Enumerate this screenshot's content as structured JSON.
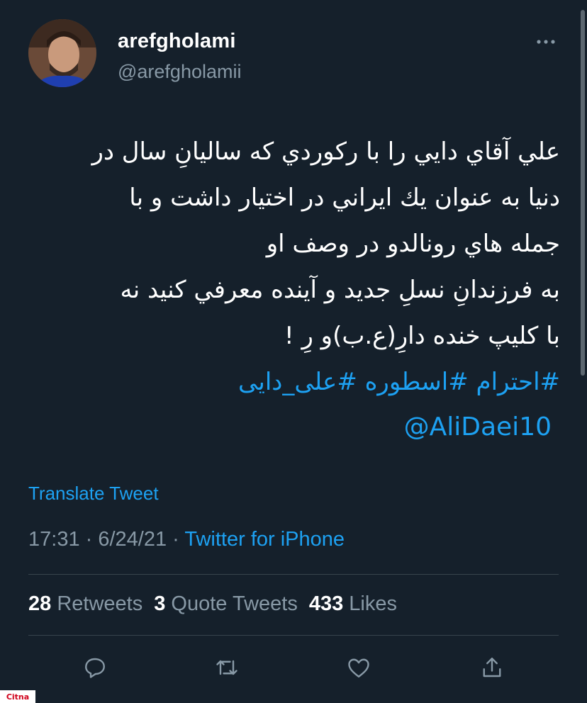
{
  "user": {
    "display_name": "arefgholami",
    "handle": "@arefgholamii"
  },
  "tweet": {
    "lines": [
      "علي آقاي دايي را با ركوردي كه ساليانِ سال  در",
      "دنيا به عنوان يك ايراني در اختيار داشت و با",
      "جمله هاي رونالدو در وصف او",
      "به فرزندانِ نسلِ جديد و آينده معرفي كنيد نه",
      "با كليپ خنده دارِ(ع.ب)و رِ !"
    ],
    "hashtags": "#احترام #اسطوره #علی_دایی",
    "mention": "@AliDaei10"
  },
  "translate_label": "Translate Tweet",
  "meta": {
    "time": "17:31",
    "separator": " · ",
    "date": "6/24/21",
    "source": "Twitter for iPhone"
  },
  "stats": {
    "retweets_count": "28",
    "retweets_label": "Retweets",
    "quote_count": "3",
    "quote_label": "Quote Tweets",
    "likes_count": "433",
    "likes_label": "Likes"
  },
  "actions": [
    "reply-icon",
    "retweet-icon",
    "like-icon",
    "share-icon"
  ],
  "watermark": "Citna",
  "colors": {
    "background": "#15202b",
    "link": "#1da1f2",
    "secondary_text": "#8899a6",
    "divider": "#38444d"
  }
}
